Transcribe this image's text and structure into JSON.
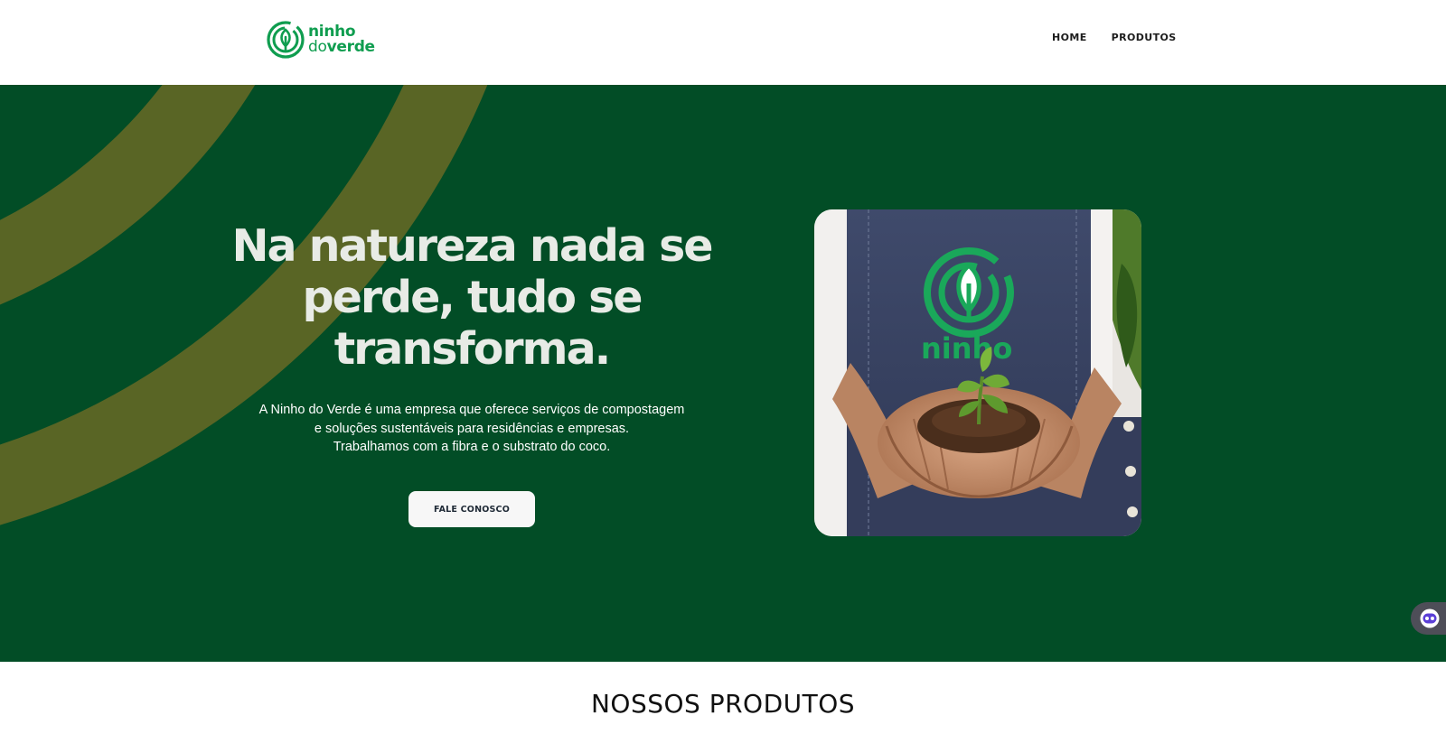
{
  "brand": {
    "name_line1": "ninho",
    "name_line2_light": "do",
    "name_line2_bold": "verde",
    "color": "#0f9d4f"
  },
  "nav": {
    "items": [
      {
        "label": "HOME"
      },
      {
        "label": "PRODUTOS"
      }
    ]
  },
  "hero": {
    "title": "Na natureza nada se perde, tudo se transforma.",
    "description_lines": [
      "A Ninho do Verde é uma empresa que oferece serviços de compostagem",
      "e soluções sustentáveis para residências e empresas.",
      "Trabalhamos com a fibra e o substrato do coco."
    ],
    "cta_label": "FALE CONOSCO",
    "photo_logo_text": "ninho verde",
    "bg_color": "#024d26",
    "arc_color": "#596525"
  },
  "chat_widget": {
    "icon": "chat-bot-icon"
  },
  "products_section": {
    "title": "NOSSOS PRODUTOS"
  }
}
